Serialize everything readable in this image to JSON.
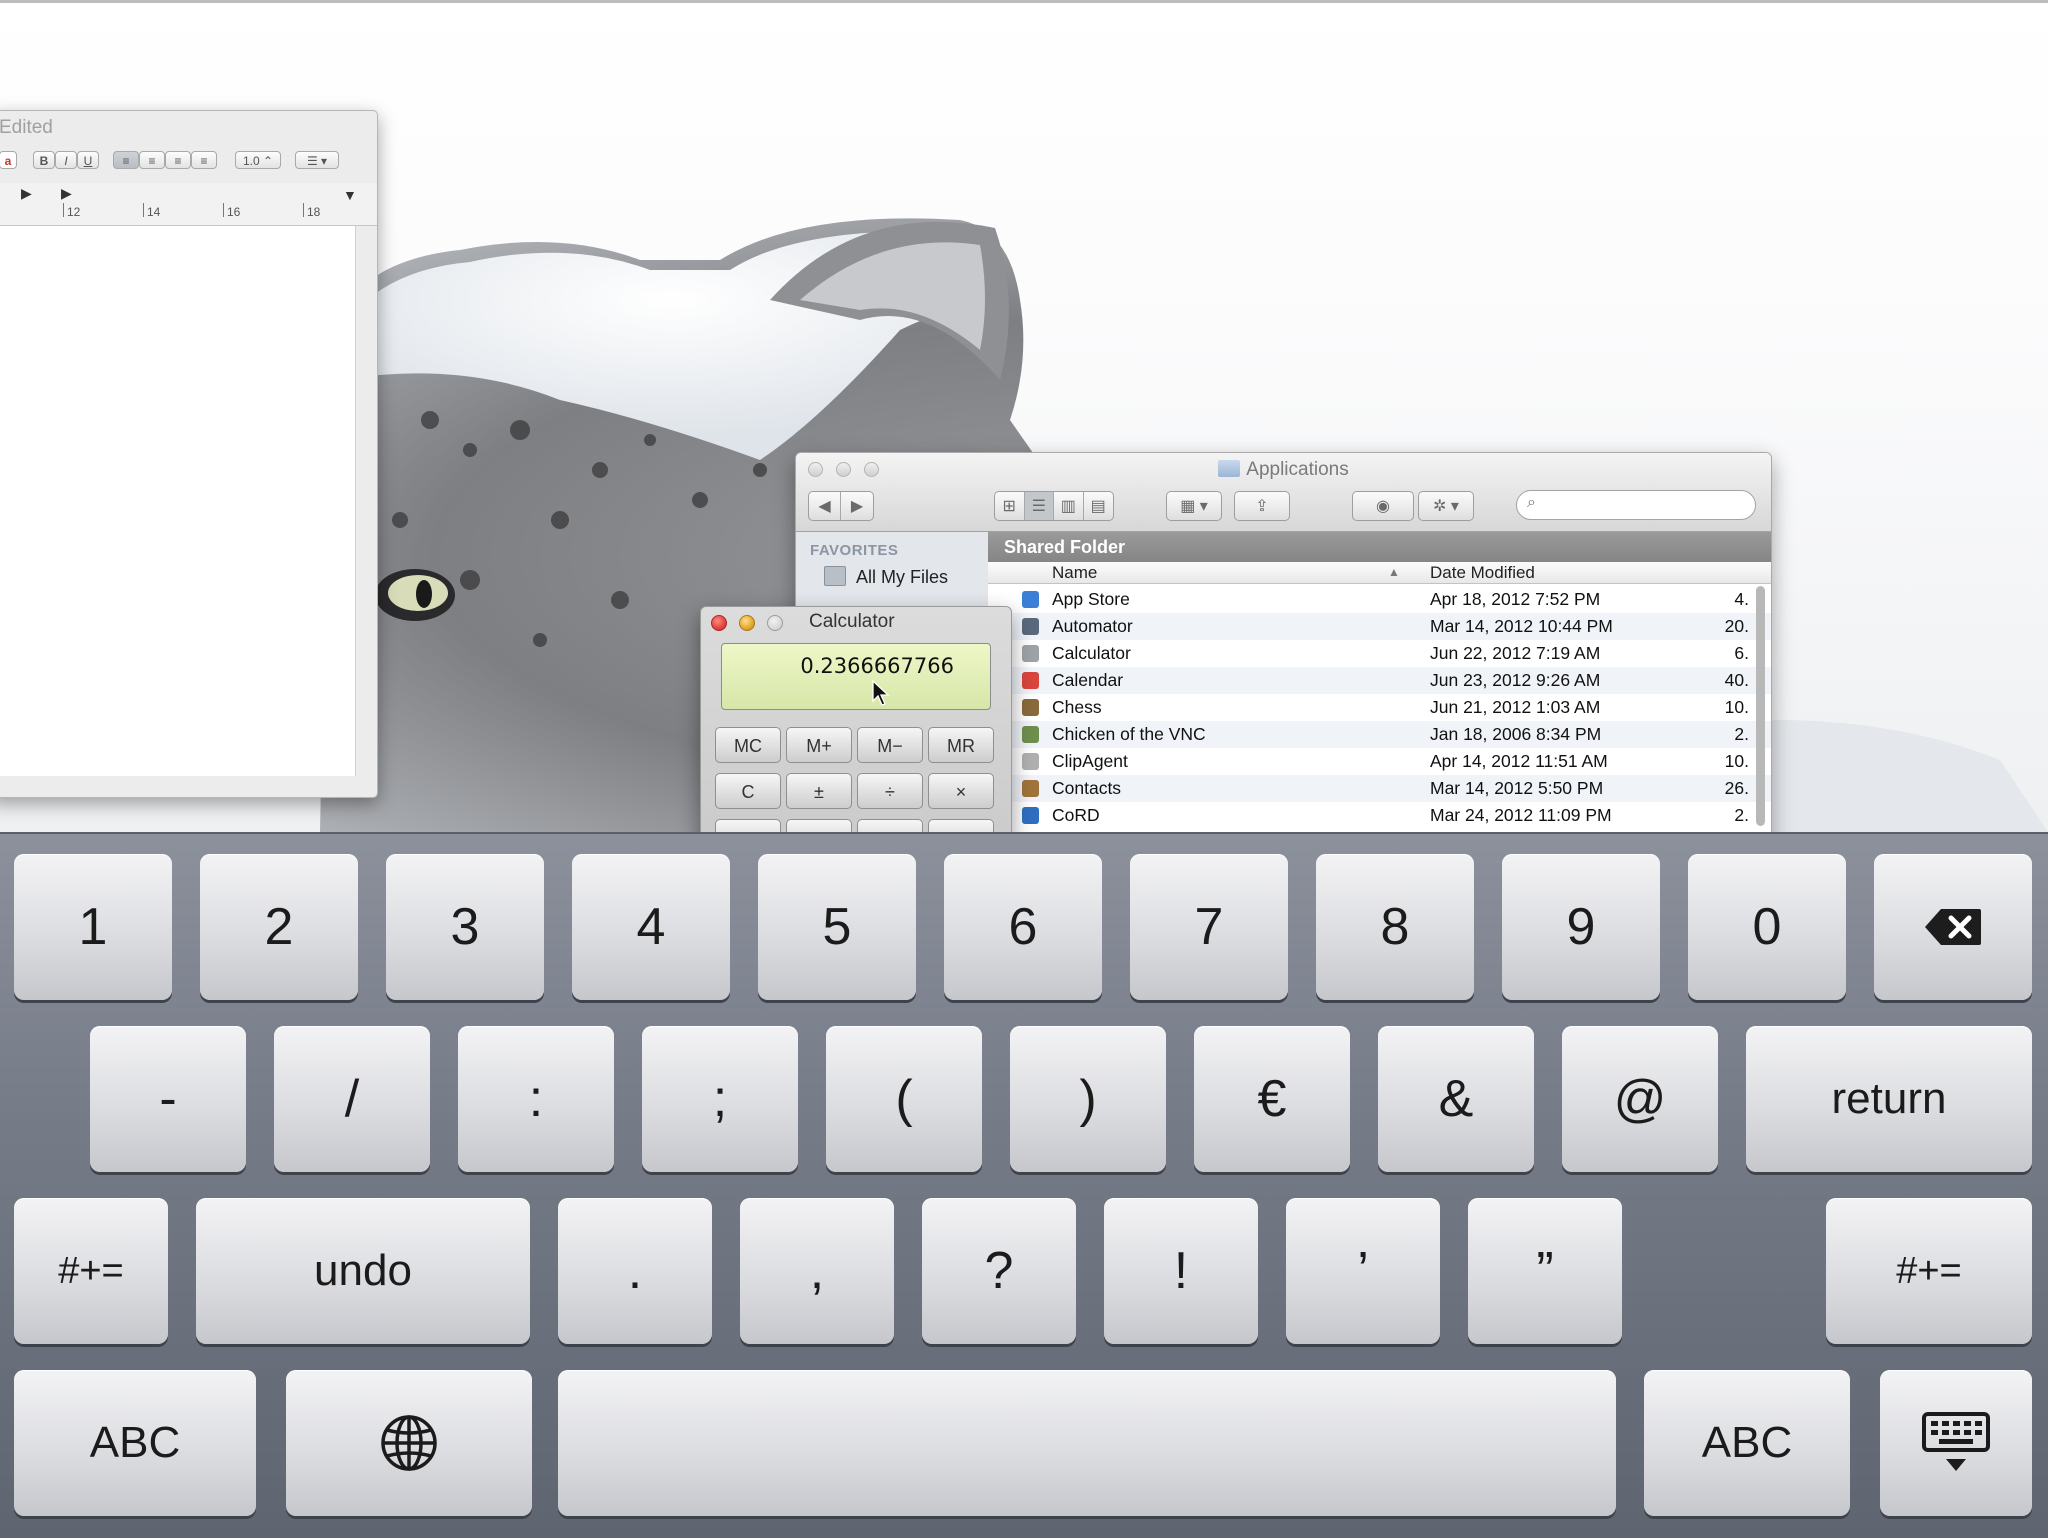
{
  "textedit": {
    "title": "Edited",
    "line_spacing": "1.0",
    "ruler_numbers": [
      "12",
      "14",
      "16",
      "18"
    ]
  },
  "finder": {
    "title": "Applications",
    "sidebar_heading": "FAVORITES",
    "sidebar_item": "All My Files",
    "path_bar": "Shared Folder",
    "columns": {
      "name": "Name",
      "date": "Date Modified"
    },
    "rows": [
      {
        "name": "App Store",
        "date": "Apr 18, 2012 7:52 PM",
        "size": "4.",
        "icon_color": "#3b7fd6"
      },
      {
        "name": "Automator",
        "date": "Mar 14, 2012 10:44 PM",
        "size": "20.",
        "icon_color": "#5a6a7c"
      },
      {
        "name": "Calculator",
        "date": "Jun 22, 2012 7:19 AM",
        "size": "6.",
        "icon_color": "#9ea3a8"
      },
      {
        "name": "Calendar",
        "date": "Jun 23, 2012 9:26 AM",
        "size": "40.",
        "icon_color": "#d9463e"
      },
      {
        "name": "Chess",
        "date": "Jun 21, 2012 1:03 AM",
        "size": "10.",
        "icon_color": "#8a6a3c"
      },
      {
        "name": "Chicken of the VNC",
        "date": "Jan 18, 2006 8:34 PM",
        "size": "2.",
        "icon_color": "#6f8f4e"
      },
      {
        "name": "ClipAgent",
        "date": "Apr 14, 2012 11:51 AM",
        "size": "10.",
        "icon_color": "#b0b0b0"
      },
      {
        "name": "Contacts",
        "date": "Mar 14, 2012 5:50 PM",
        "size": "26.",
        "icon_color": "#a0743a"
      },
      {
        "name": "CoRD",
        "date": "Mar 24, 2012 11:09 PM",
        "size": "2.",
        "icon_color": "#2e6fc2"
      }
    ]
  },
  "calculator": {
    "title": "Calculator",
    "display": "0.2366667766",
    "buttons": [
      "MC",
      "M+",
      "M−",
      "MR",
      "C",
      "±",
      "÷",
      "×"
    ]
  },
  "keyboard": {
    "row1": [
      "1",
      "2",
      "3",
      "4",
      "5",
      "6",
      "7",
      "8",
      "9",
      "0"
    ],
    "row2": [
      "-",
      "/",
      ":",
      ";",
      "(",
      ")",
      "€",
      "&",
      "@"
    ],
    "return_label": "return",
    "row3": [
      ".",
      ",",
      "?",
      "!",
      "’",
      "”"
    ],
    "symbols_label": "#+=",
    "undo_label": "undo",
    "abc_label": "ABC"
  },
  "colors": {
    "keyboard_bg": "#757b87",
    "calc_display": "#e3efb8",
    "close_red": "#e0443e",
    "minimize_yellow": "#e2a72e",
    "zoom_gray": "#c8c8c8"
  }
}
